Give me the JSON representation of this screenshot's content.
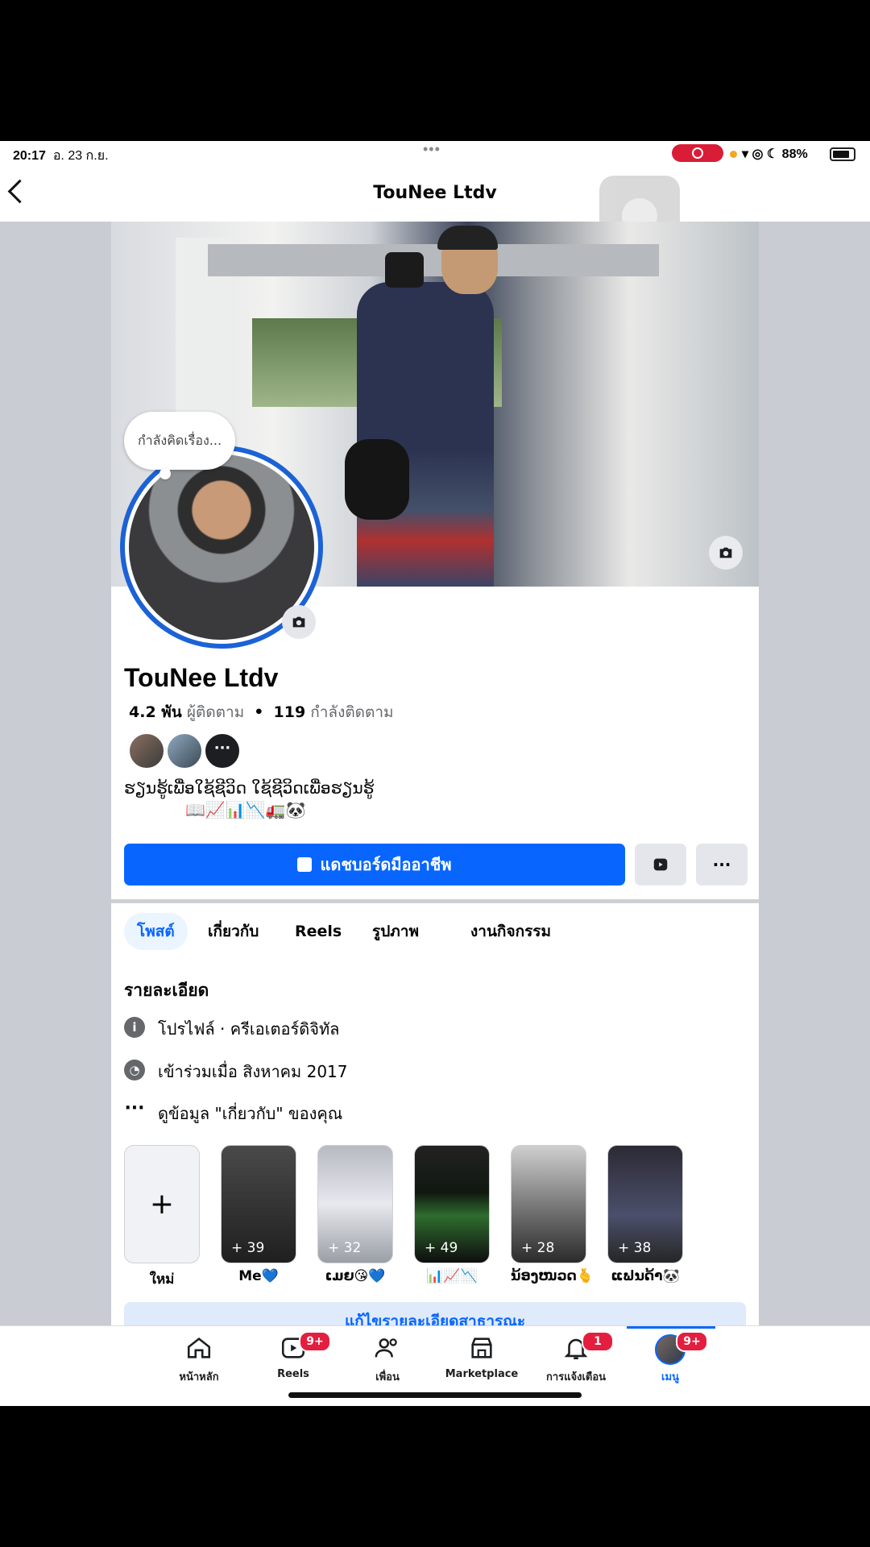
{
  "status_bar": {
    "time": "20:17",
    "date": "อ. 23 ก.ย.",
    "battery": "88%"
  },
  "header": {
    "title": "TouNee Ltdv"
  },
  "profile": {
    "thought_bubble": "กำลังคิดเรื่อง...",
    "name": "TouNee Ltdv",
    "followers_count": "4.2 พัน",
    "followers_label": "ผู้ติดตาม",
    "separator": "•",
    "following_count": "119",
    "following_label": "กำลังติดตาม",
    "mutual_more": "···",
    "bio_line1": "ຮຽນຮູ້ເພື່ອໃຊ້ຊີວິດ ໃຊ້ຊີວິດເພື່ອຮຽນຮູ້",
    "bio_line2": "📖📈📊📉🚛🐼"
  },
  "actions": {
    "dashboard_label": "แดชบอร์ดมืออาชีพ",
    "more_label": "···"
  },
  "tabs": [
    "โพสต์",
    "เกี่ยวกับ",
    "Reels",
    "รูปภาพ",
    "งานกิจกรรม"
  ],
  "details": {
    "title": "รายละเอียด",
    "items": [
      {
        "icon": "info-icon",
        "text": "โปรไฟล์ · ครีเอเตอร์ดิจิทัล"
      },
      {
        "icon": "clock-icon",
        "text": "เข้าร่วมเมื่อ สิงหาคม 2017"
      },
      {
        "icon": "more-dots-icon",
        "text": "ดูข้อมูล \"เกี่ยวกับ\" ของคุณ"
      }
    ]
  },
  "highlights": [
    {
      "label": "ใหม่",
      "count": "+"
    },
    {
      "label": "Me💙",
      "count": "+ 39"
    },
    {
      "label": "ເມຍ😘💙",
      "count": "+ 32"
    },
    {
      "label": "📊📈📉",
      "count": "+ 49"
    },
    {
      "label": "ນ້ອງໜວດ🫰",
      "count": "+ 28"
    },
    {
      "label": "ແຟນດ້າ🐼",
      "count": "+ 38"
    }
  ],
  "edit_public_details": "แก้ไขรายละเอียดสาธารณะ",
  "bottom_nav": [
    {
      "label": "หน้าหลัก",
      "icon": "home-icon",
      "badge": ""
    },
    {
      "label": "Reels",
      "icon": "reels-icon",
      "badge": "9+"
    },
    {
      "label": "เพื่อน",
      "icon": "friends-icon",
      "badge": ""
    },
    {
      "label": "Marketplace",
      "icon": "marketplace-icon",
      "badge": ""
    },
    {
      "label": "การแจ้งเตือน",
      "icon": "bell-icon",
      "badge": "1"
    },
    {
      "label": "เมนู",
      "icon": "menu-avatar-icon",
      "badge": "9+"
    }
  ],
  "colors": {
    "brand_blue": "#0866ff",
    "badge_red": "#e41e3f"
  }
}
